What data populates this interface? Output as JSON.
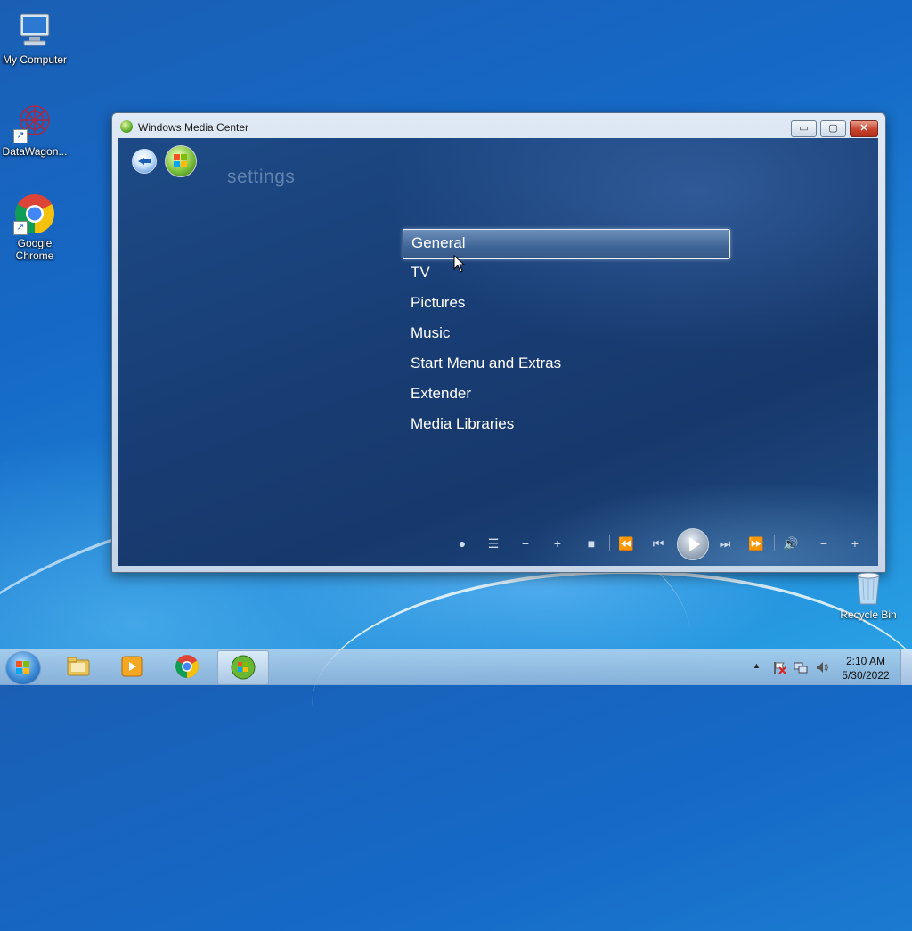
{
  "desktop": {
    "icons": [
      {
        "label": "My Computer"
      },
      {
        "label": "DataWagon..."
      },
      {
        "label": "Google Chrome"
      },
      {
        "label": "Recycle Bin"
      }
    ]
  },
  "window": {
    "title": "Windows Media Center",
    "buttons": {
      "minimize": "▭",
      "maximize": "▢",
      "close": "✕"
    }
  },
  "media_center": {
    "section_title": "settings",
    "menu": [
      {
        "label": "General",
        "selected": true
      },
      {
        "label": "TV"
      },
      {
        "label": "Pictures"
      },
      {
        "label": "Music"
      },
      {
        "label": "Start Menu and Extras"
      },
      {
        "label": "Extender"
      },
      {
        "label": "Media Libraries"
      }
    ],
    "controls": {
      "record": "●",
      "guide": "☰",
      "channel_down": "−",
      "channel_up": "+",
      "stop": "■",
      "rewind": "⏪",
      "prev": "⏮",
      "next": "⏭",
      "fast_forward": "⏩",
      "mute": "🔊",
      "volume_down": "−",
      "volume_up": "+"
    }
  },
  "taskbar": {
    "clock_time": "2:10 AM",
    "clock_date": "5/30/2022",
    "tray_arrow": "▲"
  },
  "colors": {
    "desktop_blue": "#1569c7",
    "mc_background": "#183d74",
    "selected_item": "#3f6597"
  }
}
